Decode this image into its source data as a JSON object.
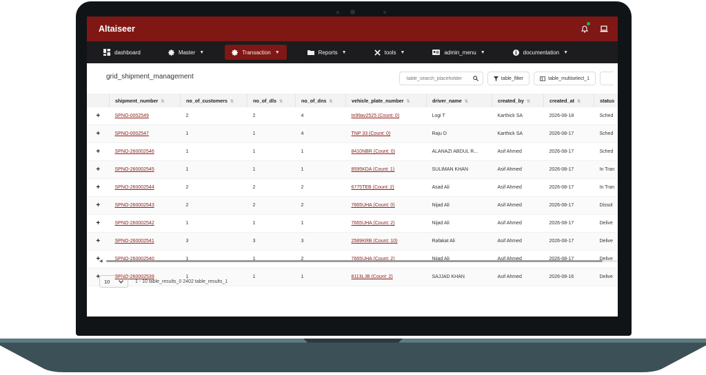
{
  "app": {
    "brand": "Altaiseer",
    "notification_icon": "bell-icon",
    "notification_badge_color": "#24b35a",
    "screen_icon": "laptop-icon"
  },
  "nav": [
    {
      "label": "dashboard",
      "icon": "dashboard-icon",
      "caret": false,
      "active": false
    },
    {
      "label": "Master",
      "icon": "gear-icon",
      "caret": true,
      "active": false
    },
    {
      "label": "Transaction",
      "icon": "gear-icon",
      "caret": true,
      "active": true
    },
    {
      "label": "Reports",
      "icon": "folder-icon",
      "caret": true,
      "active": false
    },
    {
      "label": "tools",
      "icon": "tools-icon",
      "caret": true,
      "active": false
    },
    {
      "label": "admin_menu",
      "icon": "admin-icon",
      "caret": true,
      "active": false
    },
    {
      "label": "documentation",
      "icon": "info-icon",
      "caret": true,
      "active": false
    }
  ],
  "colors": {
    "brand": "#7f1714",
    "nav_bg": "#1c1c1e",
    "link": "#8b1c18"
  },
  "grid": {
    "title": "grid_shipment_management",
    "search_placeholder": "table_search_placeholder",
    "filter_label": "table_filter",
    "multiselect_label": "table_multiselect_1",
    "columns": [
      "shipment_number",
      "no_of_customers",
      "no_of_dls",
      "no_of_dns",
      "vehicle_plate_number",
      "driver_name",
      "created_by",
      "created_at",
      "status"
    ],
    "rows": [
      {
        "shipment_number": "SPNO-0002549",
        "no_of_customers": "2",
        "no_of_dls": "2",
        "no_of_dns": "4",
        "vehicle_plate_number": "tn99av2525 (Count: 0)",
        "driver_name": "Logi T",
        "created_by": "Karthick SA",
        "created_at": "2026-08-18",
        "status": "Sched"
      },
      {
        "shipment_number": "SPNO-0002547",
        "no_of_customers": "1",
        "no_of_dls": "1",
        "no_of_dns": "4",
        "vehicle_plate_number": "TNP 33 (Count: 0)",
        "driver_name": "Raju D",
        "created_by": "Karthick SA",
        "created_at": "2026-08-17",
        "status": "Sched"
      },
      {
        "shipment_number": "SPNO-260002546",
        "no_of_customers": "1",
        "no_of_dls": "1",
        "no_of_dns": "1",
        "vehicle_plate_number": "8410NBR (Count: 0)",
        "driver_name": "ALANAZI ABDUL R...",
        "created_by": "Asif Ahmed",
        "created_at": "2026-08-17",
        "status": "Sched"
      },
      {
        "shipment_number": "SPNO-260002545",
        "no_of_customers": "1",
        "no_of_dls": "1",
        "no_of_dns": "1",
        "vehicle_plate_number": "8595KDA (Count: 1)",
        "driver_name": "SULIMAN KHAN",
        "created_by": "Asif Ahmed",
        "created_at": "2026-08-17",
        "status": "In Tran"
      },
      {
        "shipment_number": "SPNO-260002544",
        "no_of_customers": "2",
        "no_of_dls": "2",
        "no_of_dns": "2",
        "vehicle_plate_number": "6775TEB (Count: 2)",
        "driver_name": "Asad Ali",
        "created_by": "Asif Ahmed",
        "created_at": "2026-08-17",
        "status": "In Tran"
      },
      {
        "shipment_number": "SPNO-260002543",
        "no_of_customers": "2",
        "no_of_dls": "2",
        "no_of_dns": "2",
        "vehicle_plate_number": "7665UHA (Count: 0)",
        "driver_name": "Nijad Ali",
        "created_by": "Asif Ahmed",
        "created_at": "2026-08-17",
        "status": "Dissol"
      },
      {
        "shipment_number": "SPNO-260002542",
        "no_of_customers": "1",
        "no_of_dls": "1",
        "no_of_dns": "1",
        "vehicle_plate_number": "7665UHA (Count: 2)",
        "driver_name": "Nijad Ali",
        "created_by": "Asif Ahmed",
        "created_at": "2026-08-17",
        "status": "Delive"
      },
      {
        "shipment_number": "SPNO-260002541",
        "no_of_customers": "3",
        "no_of_dls": "3",
        "no_of_dns": "3",
        "vehicle_plate_number": "2589KRB (Count: 10)",
        "driver_name": "Rafakat Ali",
        "created_by": "Asif Ahmed",
        "created_at": "2026-08-17",
        "status": "Delive"
      },
      {
        "shipment_number": "SPNO-260002540",
        "no_of_customers": "1",
        "no_of_dls": "1",
        "no_of_dns": "2",
        "vehicle_plate_number": "7665UHA (Count: 2)",
        "driver_name": "Nijad Ali",
        "created_by": "Asif Ahmed",
        "created_at": "2026-08-17",
        "status": "Delive"
      },
      {
        "shipment_number": "SPNO-260002539",
        "no_of_customers": "1",
        "no_of_dls": "1",
        "no_of_dns": "1",
        "vehicle_plate_number": "8113LJB (Count: 2)",
        "driver_name": "SAJJAD KHAN",
        "created_by": "Asif Ahmed",
        "created_at": "2026-08-16",
        "status": "Delive"
      }
    ],
    "expand_symbol": "+",
    "page_size": "10",
    "pagination_text": "1 - 10 table_results_0 2402 table_results_1"
  }
}
